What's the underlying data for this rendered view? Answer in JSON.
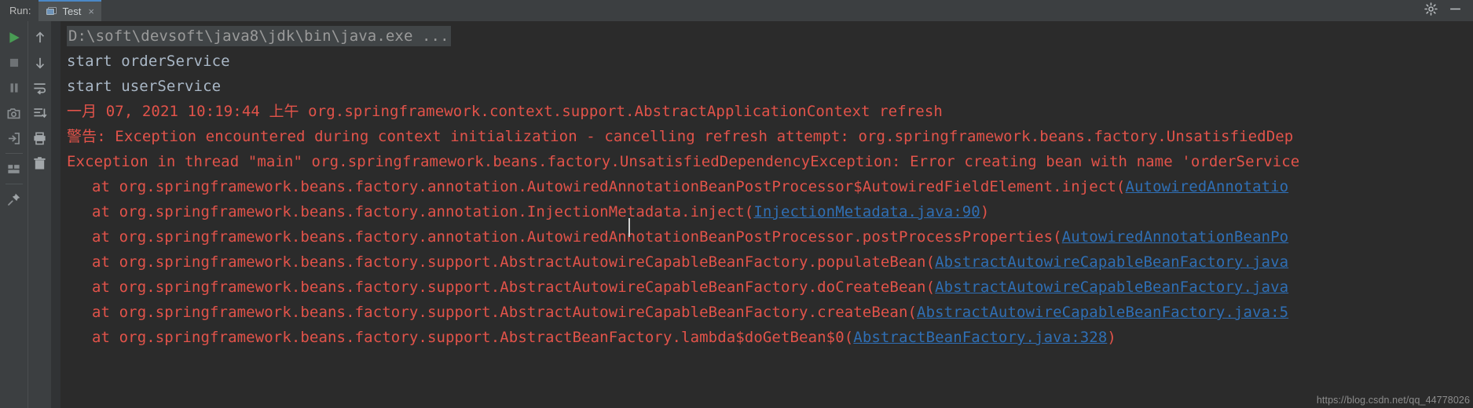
{
  "window": {
    "run_label": "Run:",
    "tab_title": "Test",
    "tab_close_glyph": "×",
    "gear_icon_name": "settings-gear-icon",
    "minimize_icon_name": "minimize-icon",
    "bg_console": "#2b2b2b",
    "bg_toolbar": "#3c3f41",
    "accent_tab": "#4a88c7"
  },
  "toolbar_left": [
    {
      "name": "rerun-button",
      "icon": "play-icon"
    },
    {
      "name": "stop-button",
      "icon": "stop-icon"
    },
    {
      "name": "pause-button",
      "icon": "pause-icon"
    },
    {
      "name": "screenshot-button",
      "icon": "camera-icon"
    },
    {
      "name": "export-button",
      "icon": "import-arrow-icon"
    },
    {
      "name": "layout-button",
      "icon": "layout-icon"
    },
    {
      "name": "pin-button",
      "icon": "pin-icon"
    }
  ],
  "toolbar_right": [
    {
      "name": "scroll-up-button",
      "icon": "arrow-up-icon"
    },
    {
      "name": "scroll-down-button",
      "icon": "arrow-down-icon"
    },
    {
      "name": "soft-wrap-button",
      "icon": "soft-wrap-icon"
    },
    {
      "name": "scroll-to-end-button",
      "icon": "scroll-end-icon"
    },
    {
      "name": "print-button",
      "icon": "printer-icon"
    },
    {
      "name": "clear-all-button",
      "icon": "trash-icon"
    }
  ],
  "console": {
    "command_line": "D:\\soft\\devsoft\\java8\\jdk\\bin\\java.exe ...",
    "stdout": [
      "start orderService",
      "start userService"
    ],
    "warn_header": "一月 07, 2021 10:19:44 上午 org.springframework.context.support.AbstractApplicationContext refresh",
    "warn_body": "警告: Exception encountered during context initialization - cancelling refresh attempt: org.springframework.beans.factory.UnsatisfiedDep",
    "exception_line": "Exception in thread \"main\" org.springframework.beans.factory.UnsatisfiedDependencyException: Error creating bean with name 'orderService",
    "stack": [
      {
        "pre": "at org.springframework.beans.factory.annotation.AutowiredAnnotationBeanPostProcessor$AutowiredFieldElement.inject(",
        "link": "AutowiredAnnotatio",
        "post": ""
      },
      {
        "pre": "at org.springframework.beans.factory.annotation.InjectionMetadata.inject(",
        "link": "InjectionMetadata.java:90",
        "post": ")"
      },
      {
        "pre": "at org.springframework.beans.factory.annotation.AutowiredAnnotationBeanPostProcessor.postProcessProperties(",
        "link": "AutowiredAnnotationBeanPo",
        "post": ""
      },
      {
        "pre": "at org.springframework.beans.factory.support.AbstractAutowireCapableBeanFactory.populateBean(",
        "link": "AbstractAutowireCapableBeanFactory.java",
        "post": ""
      },
      {
        "pre": "at org.springframework.beans.factory.support.AbstractAutowireCapableBeanFactory.doCreateBean(",
        "link": "AbstractAutowireCapableBeanFactory.java",
        "post": ""
      },
      {
        "pre": "at org.springframework.beans.factory.support.AbstractAutowireCapableBeanFactory.createBean(",
        "link": "AbstractAutowireCapableBeanFactory.java:5",
        "post": ""
      },
      {
        "pre": "at org.springframework.beans.factory.support.AbstractBeanFactory.lambda$doGetBean$0(",
        "link": "AbstractBeanFactory.java:328",
        "post": ")"
      }
    ],
    "watermark": "https://blog.csdn.net/qq_44778026"
  }
}
